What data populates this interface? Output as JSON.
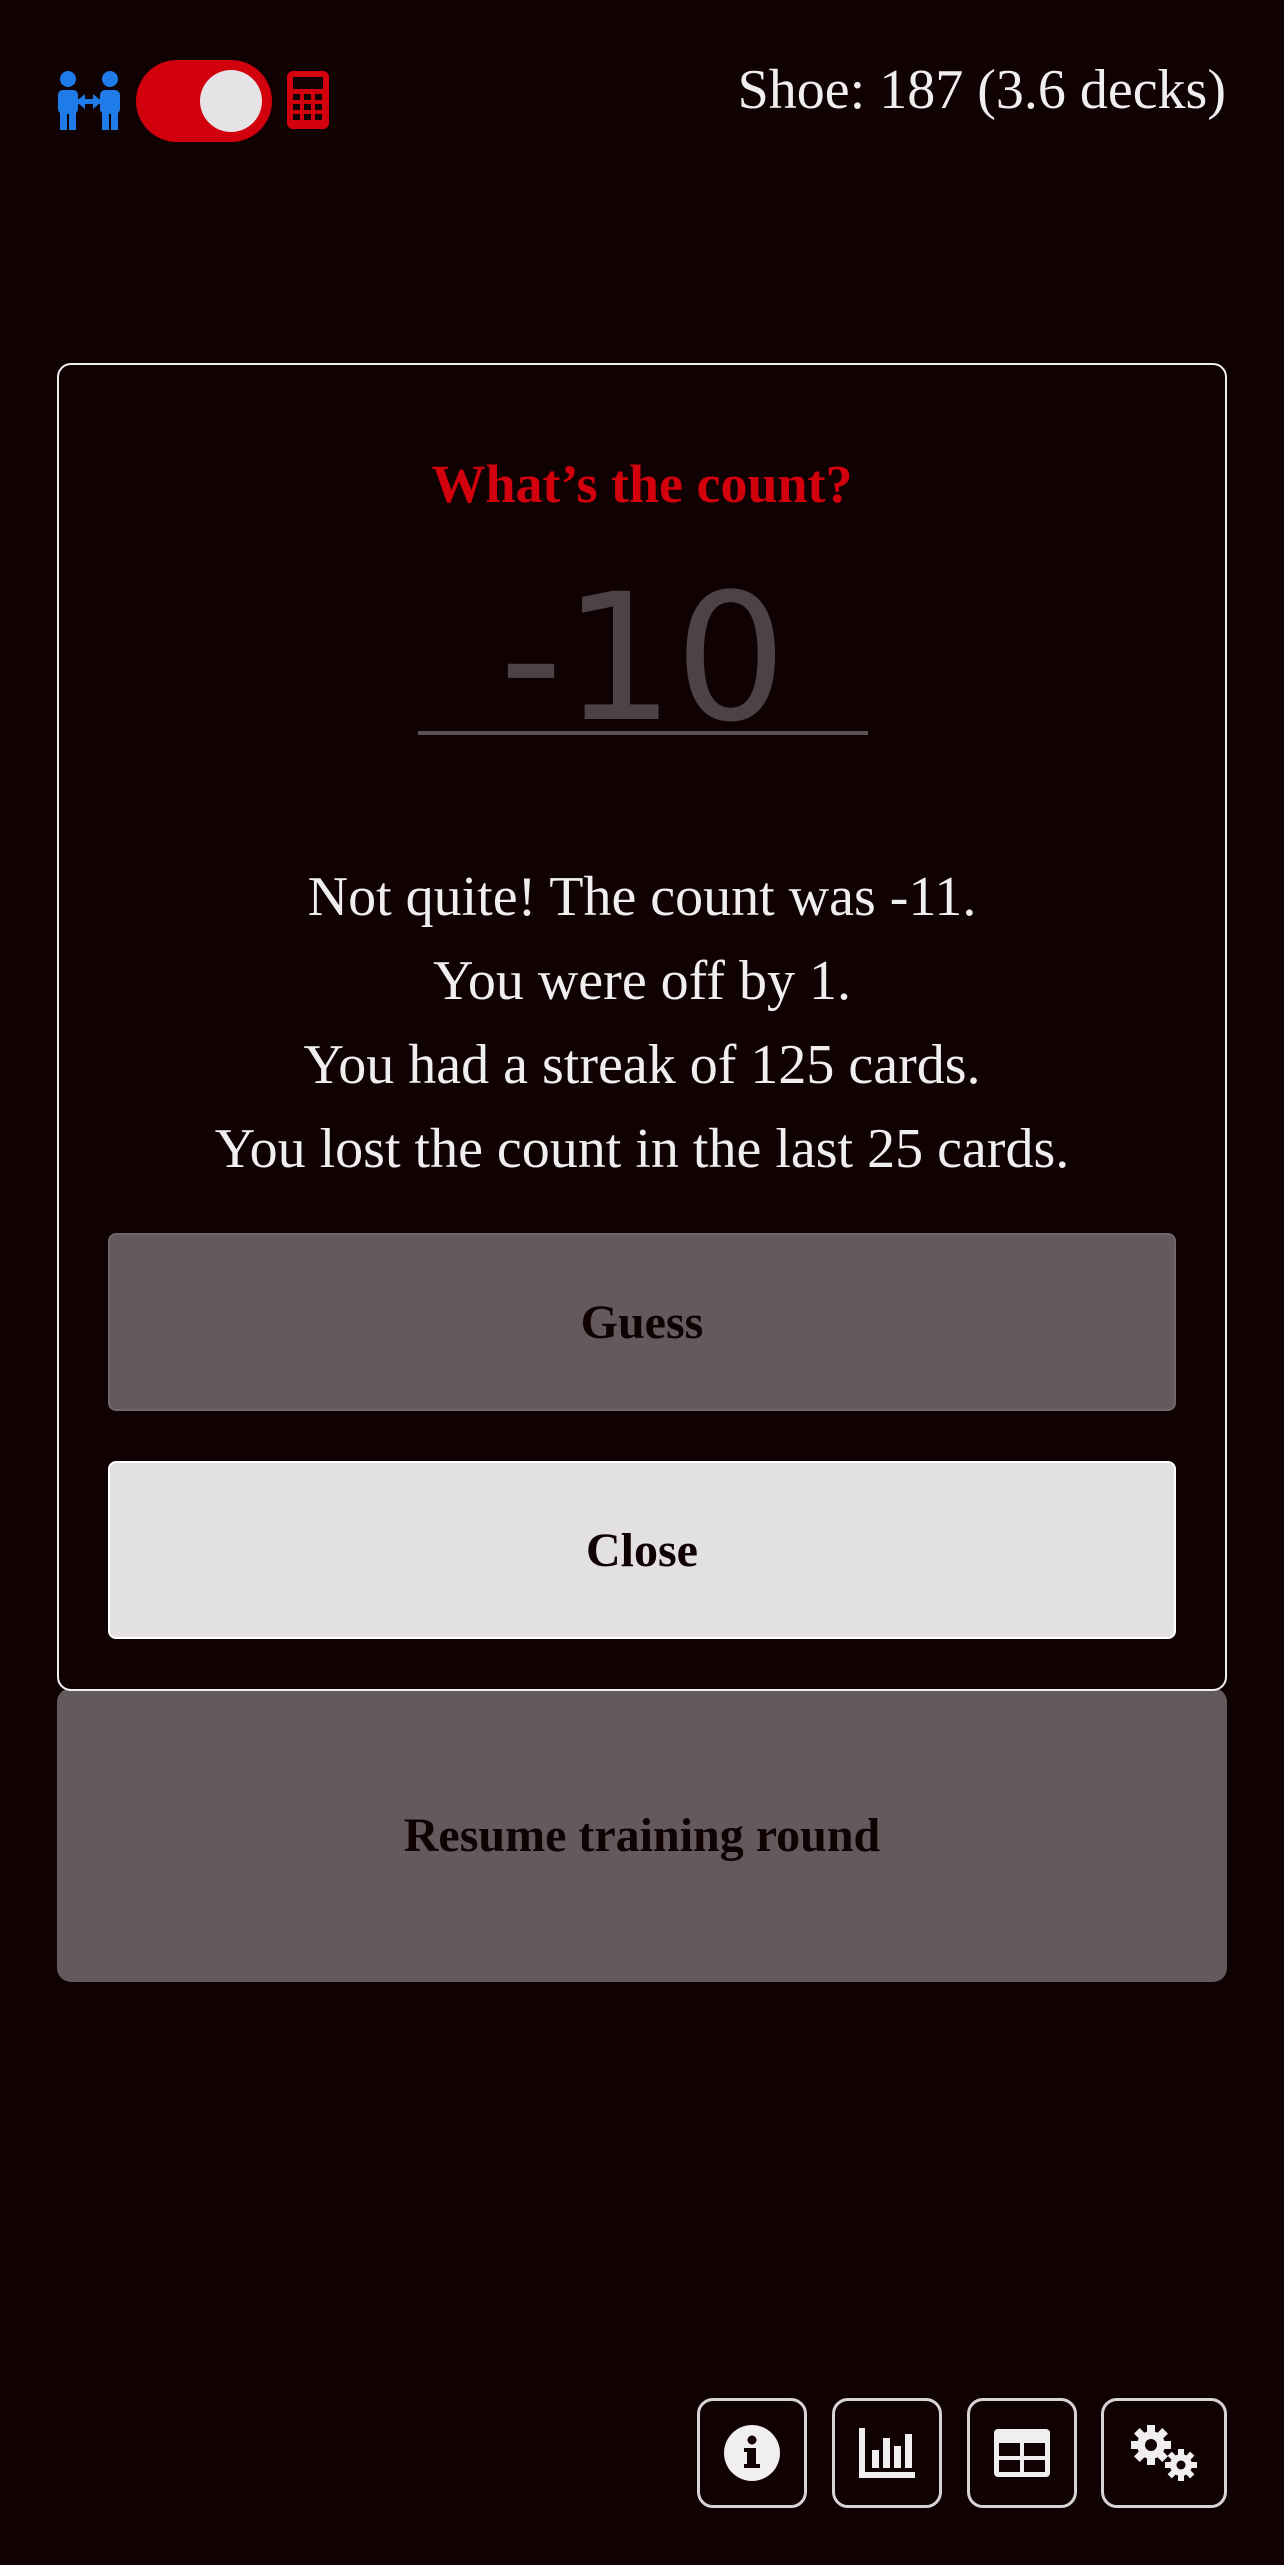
{
  "header": {
    "players_icon": "players-swap-icon",
    "mode_toggle": {
      "state": "on",
      "color": "#d2000c"
    },
    "calculator_icon": "calculator-icon",
    "shoe_status": "Shoe: 187 (3.6 decks)"
  },
  "modal": {
    "title": "What’s the count?",
    "title_color": "#d2000c",
    "count_input": {
      "placeholder": "-10",
      "value": ""
    },
    "feedback": [
      "Not quite! The count was -11.",
      "You were off by 1.",
      "You had a streak of 125 cards.",
      "You lost the count in the last 25 cards."
    ],
    "guess_label": "Guess",
    "close_label": "Close"
  },
  "resume_label": "Resume training round",
  "toolbar": {
    "buttons": [
      {
        "icon": "info-icon"
      },
      {
        "icon": "bar-chart-icon"
      },
      {
        "icon": "table-icon"
      },
      {
        "icon": "settings-gears-icon"
      }
    ]
  },
  "colors": {
    "background": "#100103",
    "accent_red": "#d2000c",
    "players_blue": "#1e7be8",
    "button_gray": "#625a5c",
    "button_light": "#e2e0e3"
  }
}
